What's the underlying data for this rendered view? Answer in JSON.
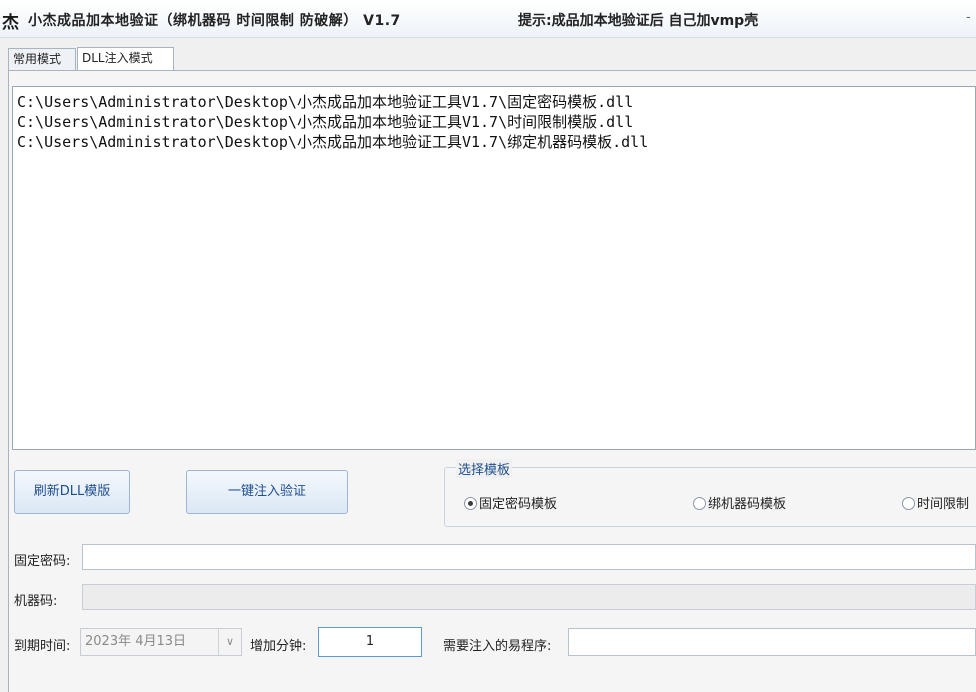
{
  "window": {
    "icon_glyph": "杰",
    "title": "小杰成品加本地验证（绑机器码 时间限制 防破解） V1.7",
    "hint": "提示:成品加本地验证后 自己加vmp壳",
    "close_glyph": "-"
  },
  "tabs": [
    {
      "label": "常用模式",
      "active": false
    },
    {
      "label": "DLL注入模式",
      "active": true
    }
  ],
  "dll_list": [
    "C:\\Users\\Administrator\\Desktop\\小杰成品加本地验证工具V1.7\\固定密码模板.dll",
    "C:\\Users\\Administrator\\Desktop\\小杰成品加本地验证工具V1.7\\时间限制模版.dll",
    "C:\\Users\\Administrator\\Desktop\\小杰成品加本地验证工具V1.7\\绑定机器码模板.dll"
  ],
  "buttons": {
    "refresh": "刷新DLL模版",
    "inject": "一键注入验证"
  },
  "template_group": {
    "legend": "选择模板",
    "options": [
      {
        "label": "固定密码模板",
        "checked": true
      },
      {
        "label": "绑机器码模板",
        "checked": false
      },
      {
        "label": "时间限制",
        "checked": false
      }
    ]
  },
  "form": {
    "fixed_password_label": "固定密码:",
    "fixed_password_value": "",
    "machine_code_label": "机器码:",
    "machine_code_value": "",
    "expiry_label": "到期时间:",
    "expiry_value": "2023年 4月13日",
    "dropdown_glyph": "∨",
    "add_minutes_label": "增加分钟:",
    "add_minutes_value": "1",
    "target_program_label": "需要注入的易程序:",
    "target_program_value": ""
  }
}
